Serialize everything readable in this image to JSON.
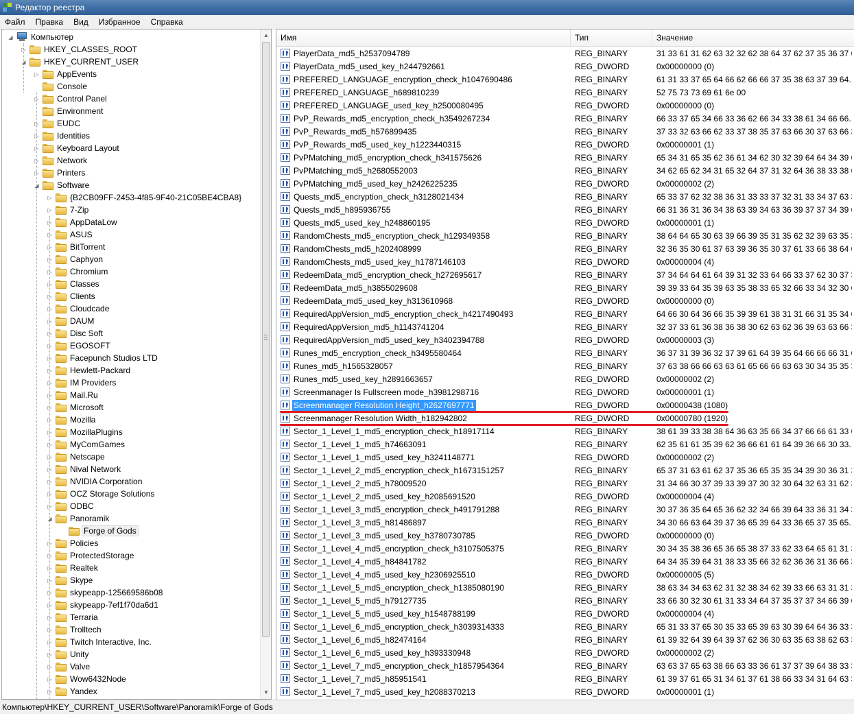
{
  "window": {
    "title": "Редактор реестра"
  },
  "menu": [
    "Файл",
    "Правка",
    "Вид",
    "Избранное",
    "Справка"
  ],
  "tree": {
    "root": {
      "label": "Компьютер",
      "icon": "computer-icon",
      "expanded": true
    },
    "hives": [
      {
        "label": "HKEY_CLASSES_ROOT",
        "expanded": false
      },
      {
        "label": "HKEY_CURRENT_USER",
        "expanded": true
      }
    ],
    "hkcu_children": [
      "AppEvents",
      "Console",
      "Control Panel",
      "Environment",
      "EUDC",
      "Identities",
      "Keyboard Layout",
      "Network",
      "Printers",
      "Software"
    ],
    "hkcu_expandable": [
      true,
      false,
      true,
      false,
      true,
      true,
      true,
      true,
      true,
      true
    ],
    "software_children": [
      "{B2CB09FF-2453-4f85-9F40-21C05BE4CBA8}",
      "7-Zip",
      "AppDataLow",
      "ASUS",
      "BitTorrent",
      "Caphyon",
      "Chromium",
      "Classes",
      "Clients",
      "Cloudcade",
      "DAUM",
      "Disc Soft",
      "EGOSOFT",
      "Facepunch Studios LTD",
      "Hewlett-Packard",
      "IM Providers",
      "Mail.Ru",
      "Microsoft",
      "Mozilla",
      "MozillaPlugins",
      "MyComGames",
      "Netscape",
      "Nival Network",
      "NVIDIA Corporation",
      "OCZ Storage Solutions",
      "ODBC",
      "Panoramik"
    ],
    "panoramik_children": [
      "Forge of Gods"
    ],
    "software_children_after": [
      "Policies",
      "ProtectedStorage",
      "Realtek",
      "Skype",
      "skypeapp-125669586b08",
      "skypeapp-7ef1f70da6d1",
      "Terraria",
      "Trolltech",
      "Twitch Interactive, Inc.",
      "Unity",
      "Valve",
      "Wow6432Node",
      "Yandex"
    ],
    "selected_key": "Forge of Gods"
  },
  "list": {
    "columns": [
      "Имя",
      "Тип",
      "Значение"
    ],
    "selected_row": 27,
    "rows": [
      [
        "PlayerData_md5_h2537094789",
        "REG_BINARY",
        "31 33 61 31 62 63 32 32 62 38 64 37 62 37 35 36 37 63..."
      ],
      [
        "PlayerData_md5_used_key_h244792661",
        "REG_DWORD",
        "0x00000000 (0)"
      ],
      [
        "PREFERED_LANGUAGE_encryption_check_h1047690486",
        "REG_BINARY",
        "61 31 33 37 65 64 66 62 66 66 37 35 38 63 37 39 64..."
      ],
      [
        "PREFERED_LANGUAGE_h689810239",
        "REG_BINARY",
        "52 75 73 73 69 61 6e 00"
      ],
      [
        "PREFERED_LANGUAGE_used_key_h2500080495",
        "REG_DWORD",
        "0x00000000 (0)"
      ],
      [
        "PvP_Rewards_md5_encryption_check_h3549267234",
        "REG_BINARY",
        "66 33 37 65 34 66 33 36 62 66 34 33 38 61 34 66 66..."
      ],
      [
        "PvP_Rewards_md5_h576899435",
        "REG_BINARY",
        "37 33 32 63 66 62 33 37 38 35 37 63 66 30 37 63 66 35..."
      ],
      [
        "PvP_Rewards_md5_used_key_h1223440315",
        "REG_DWORD",
        "0x00000001 (1)"
      ],
      [
        "PvPMatching_md5_encryption_check_h341575626",
        "REG_BINARY",
        "65 34 31 65 35 62 36 61 34 62 30 32 39 64 64 34 39 66..."
      ],
      [
        "PvPMatching_md5_h2680552003",
        "REG_BINARY",
        "34 62 65 62 34 31 65 32 64 37 31 32 64 36 38 33 38 65..."
      ],
      [
        "PvPMatching_md5_used_key_h2426225235",
        "REG_DWORD",
        "0x00000002 (2)"
      ],
      [
        "Quests_md5_encryption_check_h3128021434",
        "REG_BINARY",
        "65 33 37 62 32 38 36 31 33 33 37 32 31 33 34 37 63 32..."
      ],
      [
        "Quests_md5_h895936755",
        "REG_BINARY",
        "66 31 36 31 36 34 38 63 39 34 63 36 39 37 37 34 39 66..."
      ],
      [
        "Quests_md5_used_key_h248860195",
        "REG_DWORD",
        "0x00000001 (1)"
      ],
      [
        "RandomChests_md5_encryption_check_h129349358",
        "REG_BINARY",
        "38 64 64 65 30 63 39 66 39 35 31 35 62 32 39 63 35 36..."
      ],
      [
        "RandomChests_md5_h202408999",
        "REG_BINARY",
        "32 36 35 30 61 37 63 39 36 35 30 37 61 33 66 38 64 66..."
      ],
      [
        "RandomChests_md5_used_key_h1787146103",
        "REG_DWORD",
        "0x00000004 (4)"
      ],
      [
        "RedeemData_md5_encryption_check_h272695617",
        "REG_BINARY",
        "37 34 64 64 61 64 39 31 32 33 64 66 33 37 62 30 37 35..."
      ],
      [
        "RedeemData_md5_h3855029608",
        "REG_BINARY",
        "39 39 33 64 35 39 63 35 38 33 65 32 66 33 34 32 30 65..."
      ],
      [
        "RedeemData_md5_used_key_h313610968",
        "REG_DWORD",
        "0x00000000 (0)"
      ],
      [
        "RequiredAppVersion_md5_encryption_check_h4217490493",
        "REG_BINARY",
        "64 66 30 64 36 66 35 39 39 61 38 31 31 66 31 35 34 65..."
      ],
      [
        "RequiredAppVersion_md5_h1143741204",
        "REG_BINARY",
        "32 37 33 61 36 38 36 38 30 62 63 62 36 39 63 63 66 39 36..."
      ],
      [
        "RequiredAppVersion_md5_used_key_h3402394788",
        "REG_DWORD",
        "0x00000003 (3)"
      ],
      [
        "Runes_md5_encryption_check_h3495580464",
        "REG_BINARY",
        "36 37 31 39 36 32 37 39 61 64 39 35 64 66 66 66 31 66..."
      ],
      [
        "Runes_md5_h1565328057",
        "REG_BINARY",
        "37 63 38 66 66 63 63 61 65 66 66 63 63 30 34 35 35 38..."
      ],
      [
        "Runes_md5_used_key_h2891663657",
        "REG_DWORD",
        "0x00000002 (2)"
      ],
      [
        "Screenmanager Is Fullscreen mode_h3981298716",
        "REG_DWORD",
        "0x00000001 (1)"
      ],
      [
        "Screenmanager Resolution Height_h2627697771",
        "REG_DWORD",
        "0x00000438 (1080)"
      ],
      [
        "Screenmanager Resolution Width_h182942802",
        "REG_DWORD",
        "0x00000780 (1920)"
      ],
      [
        "Sector_1_Level_1_md5_encryption_check_h18917114",
        "REG_BINARY",
        "38 61 39 33 38 38 64 36 63 35 66 34 37 66 66 61 33 62..."
      ],
      [
        "Sector_1_Level_1_md5_h74663091",
        "REG_BINARY",
        "62 35 61 61 35 39 62 36 66 61 61 64 39 36 66 30 33..."
      ],
      [
        "Sector_1_Level_1_md5_used_key_h3241148771",
        "REG_DWORD",
        "0x00000002 (2)"
      ],
      [
        "Sector_1_Level_2_md5_encryption_check_h1673151257",
        "REG_BINARY",
        "65 37 31 63 61 62 37 35 36 65 35 35 34 39 30 36 31 30..."
      ],
      [
        "Sector_1_Level_2_md5_h78009520",
        "REG_BINARY",
        "31 34 66 30 37 39 33 39 37 30 32 30 64 32 63 31 62 35..."
      ],
      [
        "Sector_1_Level_2_md5_used_key_h2085691520",
        "REG_DWORD",
        "0x00000004 (4)"
      ],
      [
        "Sector_1_Level_3_md5_encryption_check_h491791288",
        "REG_BINARY",
        "30 37 36 35 64 65 36 62 32 34 66 39 64 33 36 31 34 38..."
      ],
      [
        "Sector_1_Level_3_md5_h81486897",
        "REG_BINARY",
        "34 30 66 63 64 39 37 36 65 39 64 33 36 65 37 35 65..."
      ],
      [
        "Sector_1_Level_3_md5_used_key_h3780730785",
        "REG_DWORD",
        "0x00000000 (0)"
      ],
      [
        "Sector_1_Level_4_md5_encryption_check_h3107505375",
        "REG_BINARY",
        "30 34 35 38 36 65 36 65 38 37 33 62 33 64 65 61 31 30..."
      ],
      [
        "Sector_1_Level_4_md5_h84841782",
        "REG_BINARY",
        "64 34 35 39 64 31 38 33 35 66 32 62 36 36 31 36 66 35..."
      ],
      [
        "Sector_1_Level_4_md5_used_key_h2306925510",
        "REG_DWORD",
        "0x00000005 (5)"
      ],
      [
        "Sector_1_Level_5_md5_encryption_check_h1385080190",
        "REG_BINARY",
        "38 63 34 34 63 62 31 32 38 34 62 39 33 66 63 31 31 38..."
      ],
      [
        "Sector_1_Level_5_md5_h79127735",
        "REG_BINARY",
        "33 66 30 32 30 61 31 33 34 64 37 35 37 37 34 66 39 66 38..."
      ],
      [
        "Sector_1_Level_5_md5_used_key_h1548788199",
        "REG_DWORD",
        "0x00000004 (4)"
      ],
      [
        "Sector_1_Level_6_md5_encryption_check_h3039314333",
        "REG_BINARY",
        "65 31 33 37 65 30 35 33 65 39 63 30 39 64 64 36 33 37..."
      ],
      [
        "Sector_1_Level_6_md5_h82474164",
        "REG_BINARY",
        "61 39 32 64 39 64 39 37 62 36 30 63 35 63 38 62 63 37..."
      ],
      [
        "Sector_1_Level_6_md5_used_key_h393330948",
        "REG_DWORD",
        "0x00000002 (2)"
      ],
      [
        "Sector_1_Level_7_md5_encryption_check_h1857954364",
        "REG_BINARY",
        "63 63 37 65 63 38 66 63 33 36 61 37 37 39 64 38 33 34 66..."
      ],
      [
        "Sector_1_Level_7_md5_h85951541",
        "REG_BINARY",
        "61 39 37 61 65 31 34 61 37 61 38 66 33 34 31 64 63 33..."
      ],
      [
        "Sector_1_Level_7_md5_used_key_h2088370213",
        "REG_DWORD",
        "0x00000001 (1)"
      ]
    ]
  },
  "status": {
    "path": "Компьютер\\HKEY_CURRENT_USER\\Software\\Panoramik\\Forge of Gods"
  },
  "colors": {
    "selection": "#3399ff",
    "annotation_line": "#e11b22",
    "titlebar": "#3f6fa6"
  }
}
